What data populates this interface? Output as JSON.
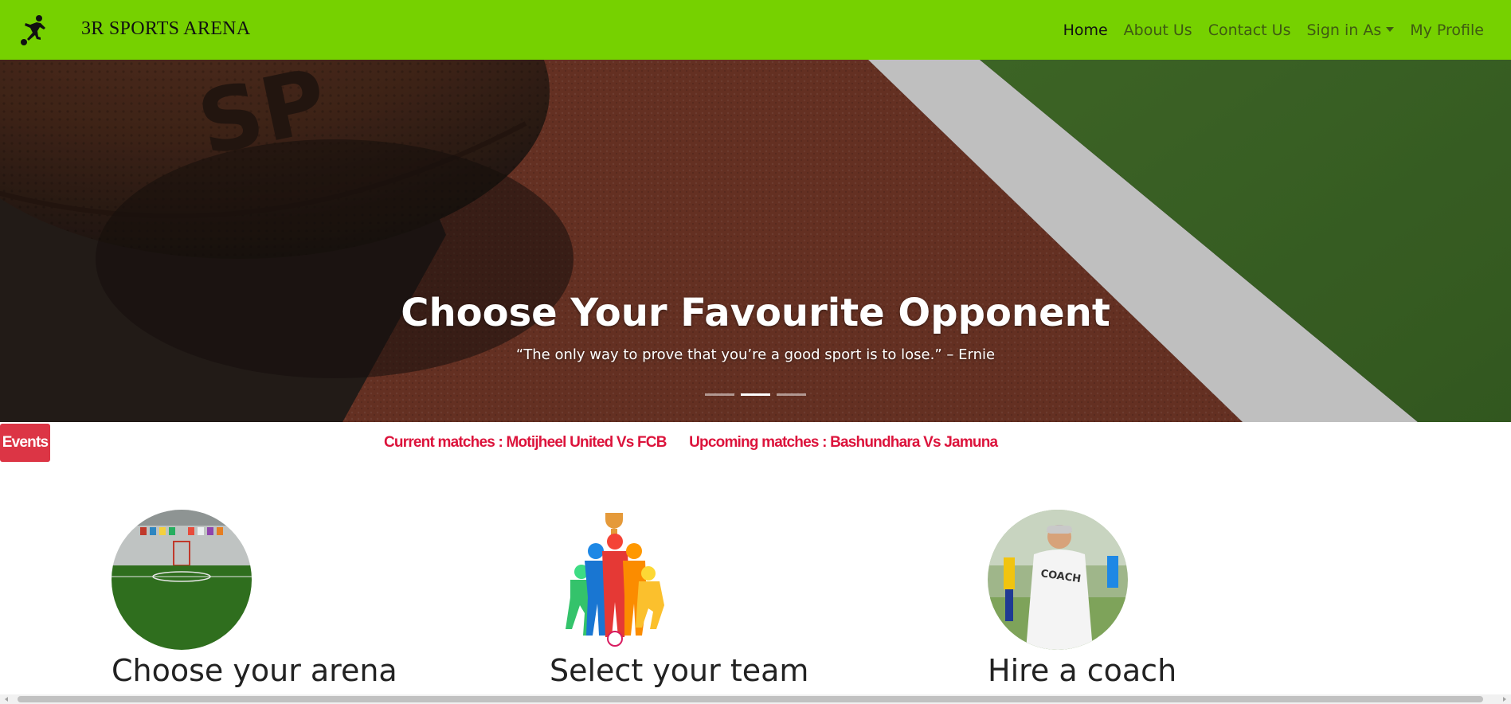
{
  "navbar": {
    "brand": "3R SPORTS ARENA",
    "links": {
      "home": "Home",
      "about": "About Us",
      "contact": "Contact Us",
      "signin": "Sign in As",
      "profile": "My Profile"
    },
    "logo_icon": "soccer-player-icon",
    "bg_color": "#76d100"
  },
  "hero": {
    "title": "Choose Your Favourite Opponent",
    "quote": "“The only way to prove that you’re a good sport is to lose.” – Ernie",
    "active_slide": 2,
    "slide_count": 3
  },
  "events": {
    "badge": "Events",
    "current": "Current matches : Motijheel United Vs FCB",
    "upcoming": "Upcoming matches : Bashundhara Vs Jamuna",
    "badge_color": "#dc3545",
    "text_color": "#dc143c"
  },
  "features": [
    {
      "title": "Choose your arena",
      "image": "indoor-arena-image"
    },
    {
      "title": "Select your team",
      "image": "team-silhouettes-image"
    },
    {
      "title": "Hire a coach",
      "image": "coach-image"
    }
  ]
}
